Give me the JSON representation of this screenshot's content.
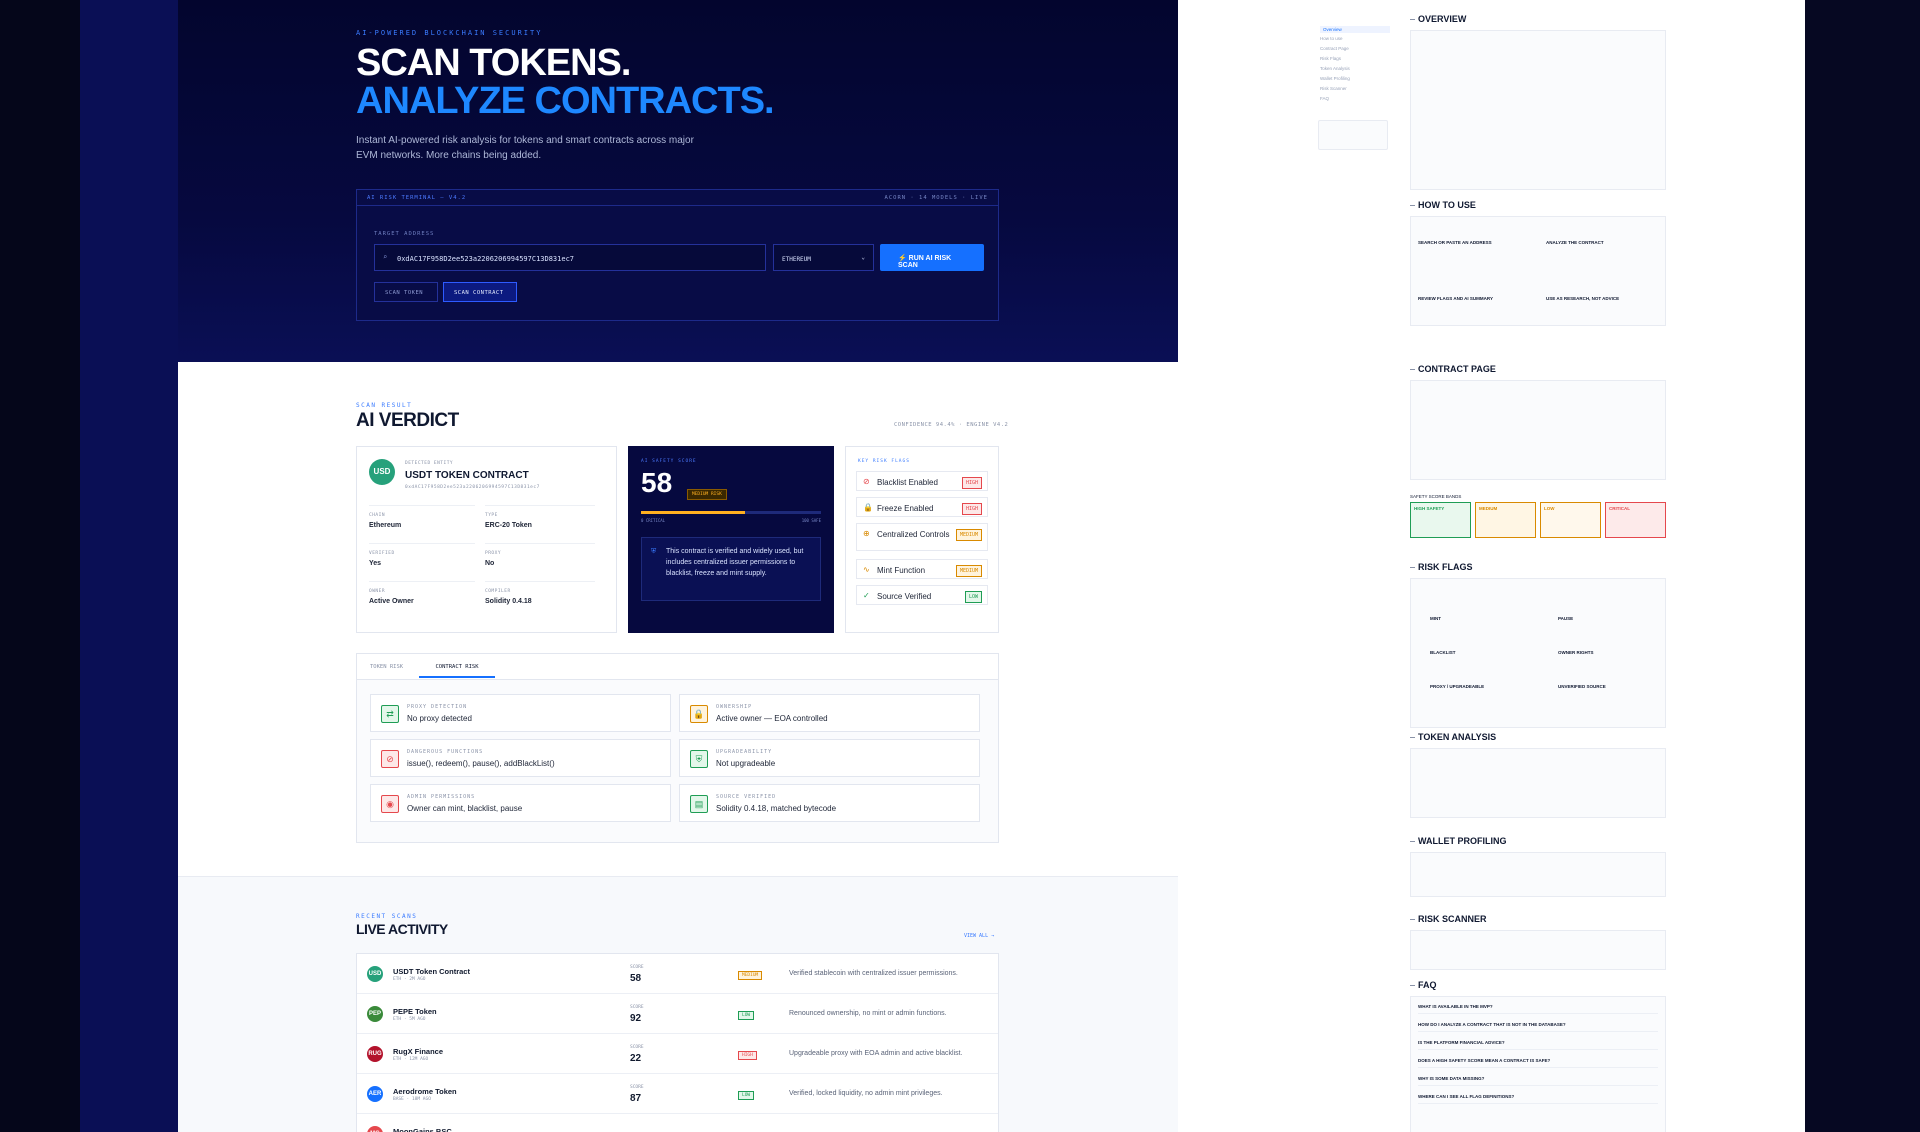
{
  "hero": {
    "eyebrow": "AI-POWERED BLOCKCHAIN SECURITY",
    "title_line1": "SCAN TOKENS.",
    "title_line2": "ANALYZE CONTRACTS.",
    "subtitle": "Instant AI-powered risk analysis for tokens and smart contracts across major EVM networks. More chains being added."
  },
  "terminal": {
    "title": "AI RISK TERMINAL — V4.2",
    "status": "ACORN · 14 MODELS · LIVE",
    "target_label": "TARGET ADDRESS",
    "address": "0xdAC17F958D2ee523a2206206994597C13D831ec7",
    "chain": "ETHEREUM",
    "run_label": "RUN AI RISK SCAN",
    "tab_token": "SCAN TOKEN",
    "tab_contract": "SCAN CONTRACT"
  },
  "verdict": {
    "eyebrow": "SCAN RESULT",
    "title": "AI VERDICT",
    "meta": "CONFIDENCE 94.4% · ENGINE V4.2",
    "entity": {
      "label": "DETECTED ENTITY",
      "avatar": "USD",
      "name": "USDT TOKEN CONTRACT",
      "address": "0xdAC17F958D2ee523a2206206994597C13D831ec7",
      "fields": [
        {
          "k": "CHAIN",
          "v": "Ethereum"
        },
        {
          "k": "TYPE",
          "v": "ERC-20 Token"
        },
        {
          "k": "VERIFIED",
          "v": "Yes"
        },
        {
          "k": "PROXY",
          "v": "No"
        },
        {
          "k": "OWNER",
          "v": "Active Owner"
        },
        {
          "k": "COMPILER",
          "v": "Solidity 0.4.18"
        }
      ]
    },
    "score": {
      "label": "AI SAFETY SCORE",
      "value": "58",
      "badge": "MEDIUM RISK",
      "min_label": "0 CRITICAL",
      "max_label": "100 SAFE",
      "progress": 0.58,
      "summary": "This contract is verified and widely used, but includes centralized issuer permissions to blacklist, freeze and mint supply."
    },
    "flags_label": "KEY RISK FLAGS",
    "flags": [
      {
        "name": "Blacklist Enabled",
        "badge": "HIGH"
      },
      {
        "name": "Freeze Enabled",
        "badge": "HIGH"
      },
      {
        "name": "Centralized Controls",
        "badge": "MEDIUM"
      },
      {
        "name": "Mint Function",
        "badge": "MEDIUM"
      },
      {
        "name": "Source Verified",
        "badge": "LOW"
      }
    ]
  },
  "risk": {
    "tab_token": "TOKEN RISK",
    "tab_contract": "CONTRACT RISK",
    "items": [
      {
        "k": "PROXY DETECTION",
        "v": "No proxy detected"
      },
      {
        "k": "OWNERSHIP",
        "v": "Active owner — EOA controlled"
      },
      {
        "k": "DANGEROUS FUNCTIONS",
        "v": "issue(), redeem(), pause(), addBlackList()"
      },
      {
        "k": "UPGRADEABILITY",
        "v": "Not upgradeable"
      },
      {
        "k": "ADMIN PERMISSIONS",
        "v": "Owner can mint, blacklist, pause"
      },
      {
        "k": "SOURCE VERIFIED",
        "v": "Solidity 0.4.18, matched bytecode"
      }
    ]
  },
  "activity": {
    "eyebrow": "RECENT SCANS",
    "title": "LIVE ACTIVITY",
    "view_all": "VIEW ALL →",
    "score_label": "SCORE",
    "rows": [
      {
        "av": "USD",
        "name": "USDT Token Contract",
        "meta": "ETH · 2M AGO",
        "score": "58",
        "badge": "MEDIUM",
        "desc": "Verified stablecoin with centralized issuer permissions."
      },
      {
        "av": "PEP",
        "name": "PEPE Token",
        "meta": "ETH · 5M AGO",
        "score": "92",
        "badge": "LOW",
        "desc": "Renounced ownership, no mint or admin functions."
      },
      {
        "av": "RUG",
        "name": "RugX Finance",
        "meta": "ETH · 12M AGO",
        "score": "22",
        "badge": "HIGH",
        "desc": "Upgradeable proxy with EOA admin and active blacklist."
      },
      {
        "av": "AER",
        "name": "Aerodrome Token",
        "meta": "BASE · 18M AGO",
        "score": "87",
        "badge": "LOW",
        "desc": "Verified, locked liquidity, no admin mint privileges."
      },
      {
        "av": "MG",
        "name": "MoonGains BSC",
        "meta": "",
        "score": "",
        "badge": "",
        "desc": ""
      }
    ]
  },
  "docs": {
    "nav": [
      "Overview",
      "How to use",
      "Contract Page",
      "Risk Flags",
      "Token Analysis",
      "Wallet Profiling",
      "Risk Scanner",
      "FAQ"
    ],
    "sections": [
      "OVERVIEW",
      "HOW TO USE",
      "CONTRACT PAGE",
      "RISK FLAGS",
      "TOKEN ANALYSIS",
      "WALLET PROFILING",
      "RISK SCANNER",
      "FAQ"
    ],
    "bands": [
      "HIGH SAFETY",
      "MEDIUM",
      "LOW",
      "CRITICAL"
    ],
    "bands_label": "SAFETY SCORE BANDS",
    "steps": [
      "SEARCH OR PASTE AN ADDRESS",
      "ANALYZE THE CONTRACT",
      "REVIEW FLAGS AND AI SUMMARY",
      "USE AS RESEARCH, NOT ADVICE"
    ],
    "flags": [
      "MINT",
      "PAUSE",
      "BLACKLIST",
      "OWNER RIGHTS",
      "PROXY / UPGRADEABLE",
      "UNVERIFIED SOURCE"
    ],
    "faq": [
      "WHAT IS AVAILABLE IN THE MVP?",
      "HOW DO I ANALYZE A CONTRACT THAT IS NOT IN THE DATABASE?",
      "IS THE PLATFORM FINANCIAL ADVICE?",
      "DOES A HIGH SAFETY SCORE MEAN A CONTRACT IS SAFE?",
      "WHY IS SOME DATA MISSING?",
      "WHERE CAN I SEE ALL FLAG DEFINITIONS?"
    ]
  }
}
